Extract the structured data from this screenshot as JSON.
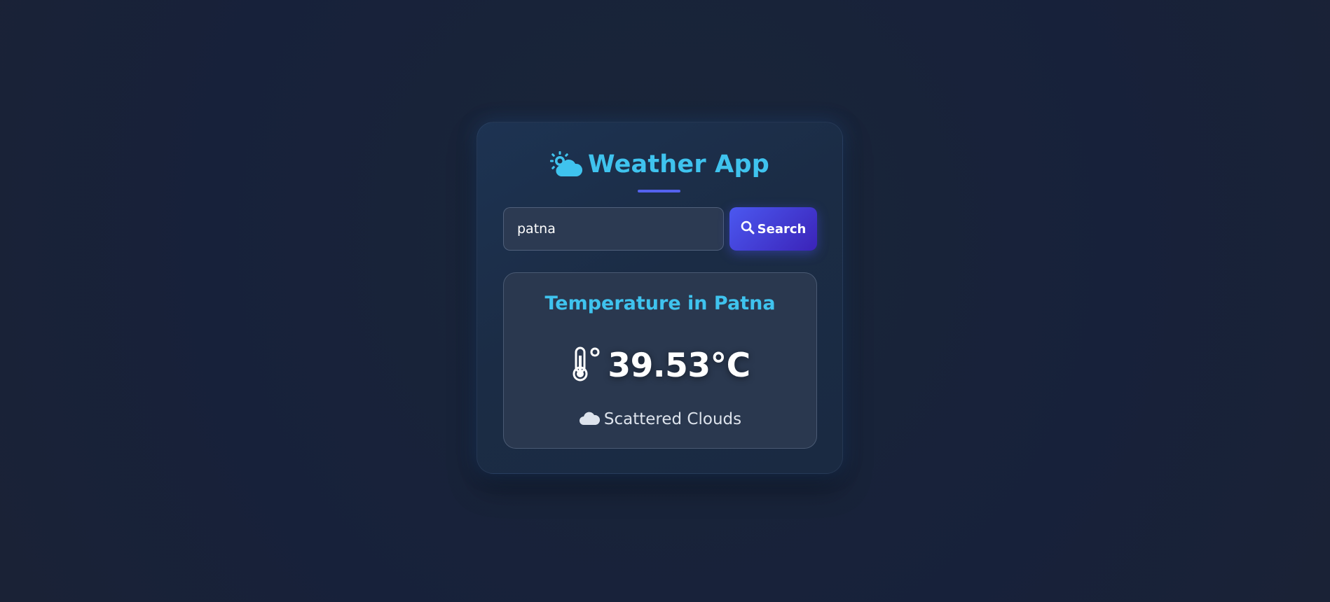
{
  "app": {
    "title": "Weather App",
    "icon": "sun-cloud-icon",
    "accent_color": "#3fc3ee",
    "underline_color": "#5462ef"
  },
  "search": {
    "value": "patna",
    "button_label": "Search",
    "button_icon": "search-icon"
  },
  "result": {
    "title": "Temperature in Patna",
    "temperature": "39.53°C",
    "temperature_icon": "thermometer-icon",
    "condition": "Scattered Clouds",
    "condition_icon": "cloud-icon"
  }
}
